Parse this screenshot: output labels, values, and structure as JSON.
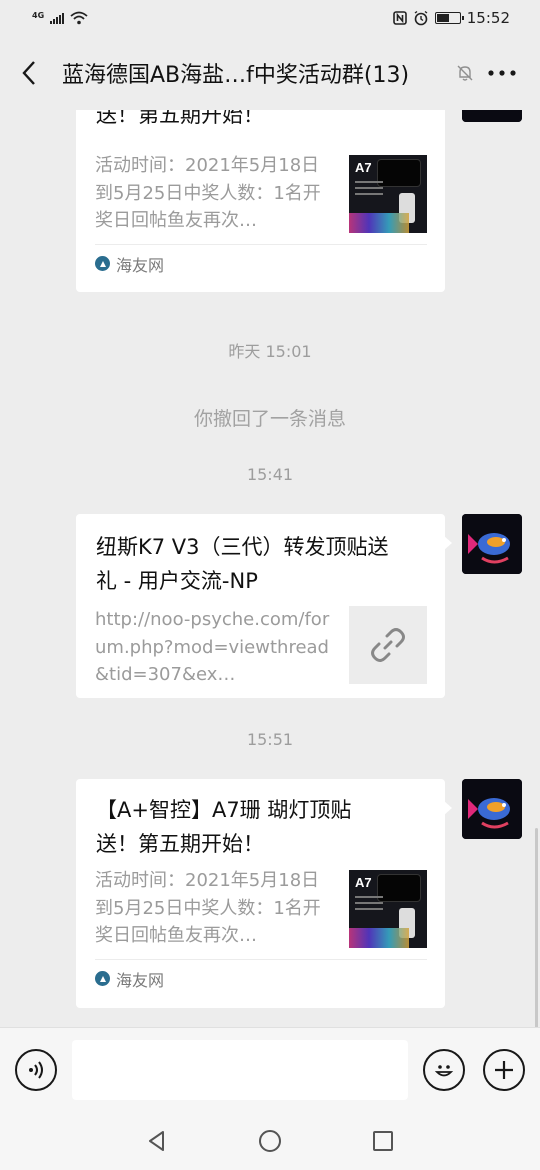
{
  "status_bar": {
    "network": "4G",
    "time": "15:52",
    "icons": [
      "nfc-icon",
      "alarm-icon",
      "battery-icon"
    ],
    "battery_level": 0.55
  },
  "header": {
    "title": "蓝海德国AB海盐…f中奖活动群(13)",
    "icons": [
      "back-icon",
      "mute-icon",
      "more-icon"
    ]
  },
  "messages": {
    "card1": {
      "title_tail": "送！第五期开始！",
      "description": "活动时间：2021年5月18日到5月25日中奖人数：1名开奖日回帖鱼友再次…",
      "thumb_label": "A7",
      "source": "海友网"
    },
    "stamp1": "昨天 15:01",
    "recall_notice": "你撤回了一条消息",
    "stamp2": "15:41",
    "card2": {
      "title": "纽斯K7 V3（三代）转发顶贴送礼 - 用户交流-NP",
      "url": "http://noo-psyche.com/forum.php?mod=viewthread&tid=307&ex…",
      "thumb_icon": "link-icon"
    },
    "stamp3": "15:51",
    "card3": {
      "title": "【A+智控】A7珊 瑚灯顶贴送！第五期开始！",
      "description": "活动时间：2021年5月18日到5月25日中奖人数：1名开奖日回帖鱼友再次…",
      "thumb_label": "A7",
      "source": "海友网"
    }
  },
  "input_bar": {
    "icons": [
      "voice-icon",
      "emoji-icon",
      "plus-icon"
    ],
    "placeholder": ""
  },
  "nav_bar": {
    "icons": [
      "back-triangle-icon",
      "home-circle-icon",
      "recents-square-icon"
    ]
  },
  "colors": {
    "background": "#ededed",
    "bubble": "#ffffff",
    "muted_text": "#9b9b9b"
  }
}
